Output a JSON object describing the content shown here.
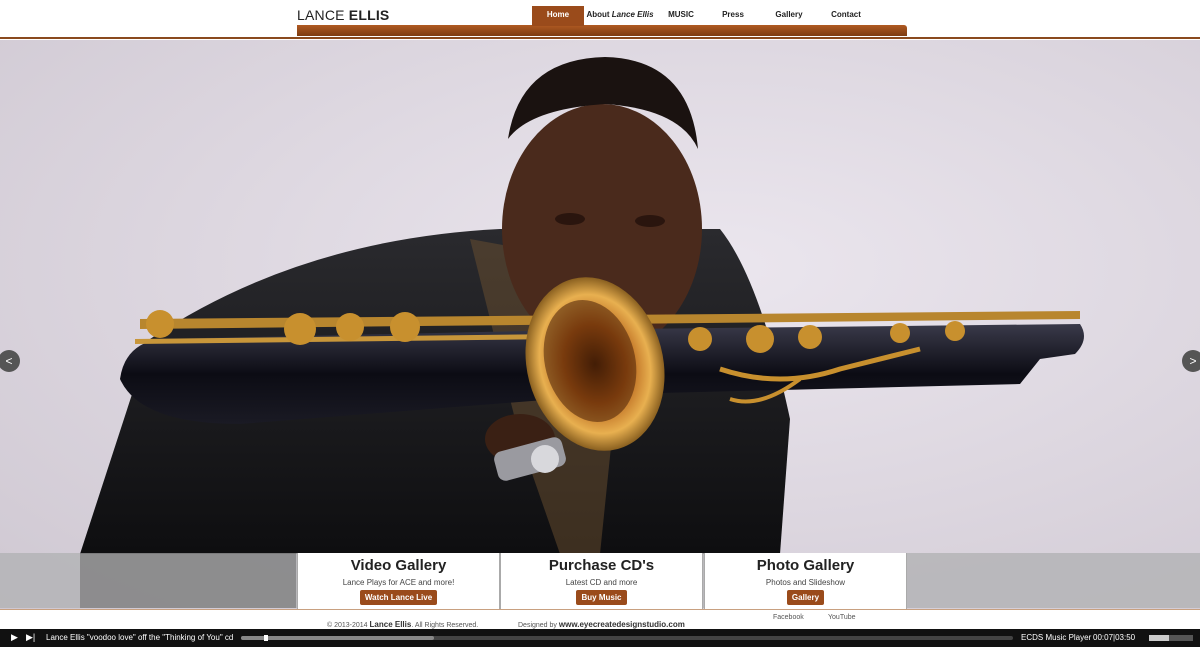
{
  "header": {
    "logo_first": "LANCE",
    "logo_last": "ELLIS",
    "nav": [
      {
        "label": "Home",
        "active": true
      },
      {
        "label_prefix": "About ",
        "label_em": "Lance Ellis"
      },
      {
        "label": "MUSIC"
      },
      {
        "label": "Press"
      },
      {
        "label": "Gallery"
      },
      {
        "label": "Contact"
      }
    ]
  },
  "hero": {
    "prev_label": "<",
    "next_label": ">"
  },
  "cards": [
    {
      "title": "Video Gallery",
      "subtitle": "Lance Plays for ACE and more!",
      "button": "Watch Lance Live"
    },
    {
      "title": "Purchase CD's",
      "subtitle": "Latest CD and more",
      "button": "Buy Music"
    },
    {
      "title": "Photo Gallery",
      "subtitle": "Photos and Slideshow",
      "button": "Gallery"
    }
  ],
  "footer": {
    "copyright_prefix": "© 2013-2014",
    "copyright_name": "Lance Ellis",
    "copyright_suffix": ". All Rights Reserved.",
    "designed_prefix": "Designed by",
    "designed_site": "www.eyecreatedesignstudio.com",
    "links": [
      "Facebook",
      "YouTube"
    ]
  },
  "player": {
    "track": "Lance Ellis \"voodoo love\" off the \"Thinking of You\" cd",
    "player_name": "ECDS Music Player",
    "time": "00:07|03:50",
    "progress_buffered": 0.25,
    "progress_played": 0.03,
    "volume": 0.45
  },
  "colors": {
    "accent": "#9a4b1b",
    "rule": "#8a4a1e"
  }
}
